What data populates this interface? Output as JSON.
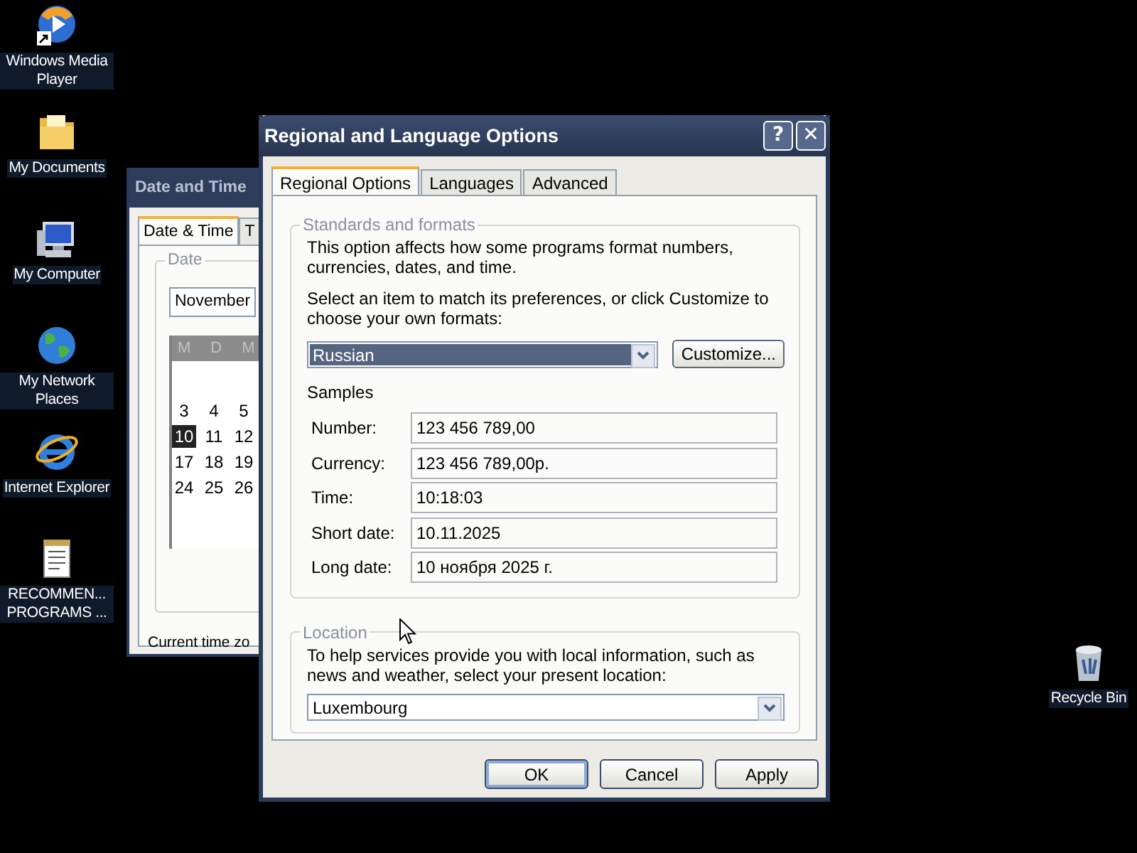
{
  "desktop_icons": [
    {
      "label": "Windows Media Player",
      "kind": "media",
      "shortcut": true
    },
    {
      "label": "My Documents",
      "kind": "folder",
      "shortcut": false
    },
    {
      "label": "My Computer",
      "kind": "computer",
      "shortcut": false
    },
    {
      "label": "My Network Places",
      "kind": "globe",
      "shortcut": false
    },
    {
      "label": "Internet Explorer",
      "kind": "browser",
      "shortcut": false
    },
    {
      "label": "RECOMMEN... PROGRAMS ...",
      "kind": "notepad",
      "shortcut": false
    }
  ],
  "recycle_bin": {
    "label": "Recycle Bin"
  },
  "date_time_window": {
    "title": "Date and Time",
    "tabs": [
      {
        "label": "Date & Time",
        "selected": true
      },
      {
        "label": "T",
        "selected": false
      }
    ],
    "date_group": "Date",
    "month": "November",
    "weekdays": [
      "M",
      "D",
      "M"
    ],
    "days": [
      [
        {
          "label": "3",
          "selected": false
        },
        {
          "label": "4",
          "selected": false
        },
        {
          "label": "5",
          "selected": false
        }
      ],
      [
        {
          "label": "10",
          "selected": true
        },
        {
          "label": "11",
          "selected": false
        },
        {
          "label": "12",
          "selected": false
        }
      ],
      [
        {
          "label": "17",
          "selected": false
        },
        {
          "label": "18",
          "selected": false
        },
        {
          "label": "19",
          "selected": false
        }
      ],
      [
        {
          "label": "24",
          "selected": false
        },
        {
          "label": "25",
          "selected": false
        },
        {
          "label": "26",
          "selected": false
        }
      ]
    ],
    "time_zone_text": "Current time zo"
  },
  "regional_window": {
    "title": "Regional and Language Options",
    "help_button": "?",
    "close_button": "✕",
    "tabs": [
      {
        "label": "Regional Options",
        "selected": true
      },
      {
        "label": "Languages",
        "selected": false
      },
      {
        "label": "Advanced",
        "selected": false
      }
    ],
    "standards_group": {
      "title": "Standards and formats",
      "description": "This option affects how some programs format numbers, currencies, dates, and time.",
      "instruction": "Select an item to match its preferences, or click Customize to choose your own formats:",
      "format": {
        "value": "Russian",
        "highlighted": true
      },
      "customize_button": "Customize...",
      "samples_label": "Samples",
      "samples": [
        {
          "label": "Number:",
          "value": "123 456 789,00"
        },
        {
          "label": "Currency:",
          "value": "123 456 789,00р."
        },
        {
          "label": "Time:",
          "value": "10:18:03"
        },
        {
          "label": "Short date:",
          "value": "10.11.2025"
        },
        {
          "label": "Long date:",
          "value": "10 ноября 2025 г."
        }
      ]
    },
    "location_group": {
      "title": "Location",
      "description": "To help services provide you with local information, such as news and weather, select your present location:",
      "location": {
        "value": "Luxembourg",
        "highlighted": false
      }
    },
    "buttons": [
      {
        "label": "OK",
        "default": true
      },
      {
        "label": "Cancel",
        "default": false
      },
      {
        "label": "Apply",
        "default": false
      }
    ]
  }
}
